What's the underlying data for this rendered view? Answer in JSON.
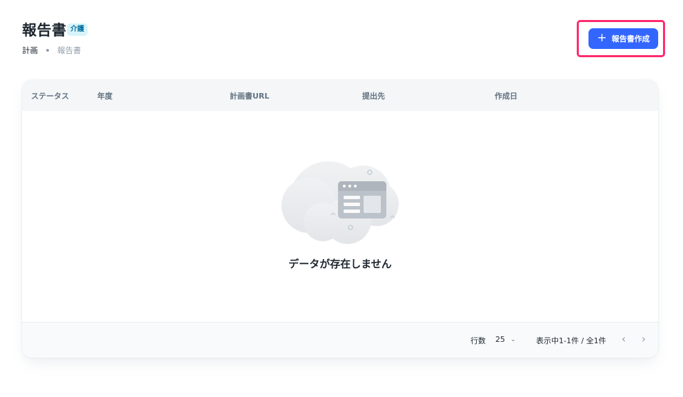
{
  "header": {
    "title": "報告書",
    "badge": "介護",
    "breadcrumb": [
      "計画",
      "報告書"
    ]
  },
  "actions": {
    "create_label": "報告書作成",
    "create_icon": "plus-icon"
  },
  "table": {
    "columns": [
      "ステータス",
      "年度",
      "計画書URL",
      "提出先",
      "作成日"
    ],
    "rows": [],
    "empty_message": "データが存在しません"
  },
  "pagination": {
    "rows_label": "行数",
    "rows_per_page": "25",
    "range_text": "表示中1-1件 / 全1件",
    "prev_icon": "chevron-left-icon",
    "next_icon": "chevron-right-icon"
  },
  "colors": {
    "primary": "#3366ff",
    "highlight": "#ff2a6d",
    "badge_bg": "#d6f4f9",
    "badge_text": "#006c9c"
  }
}
